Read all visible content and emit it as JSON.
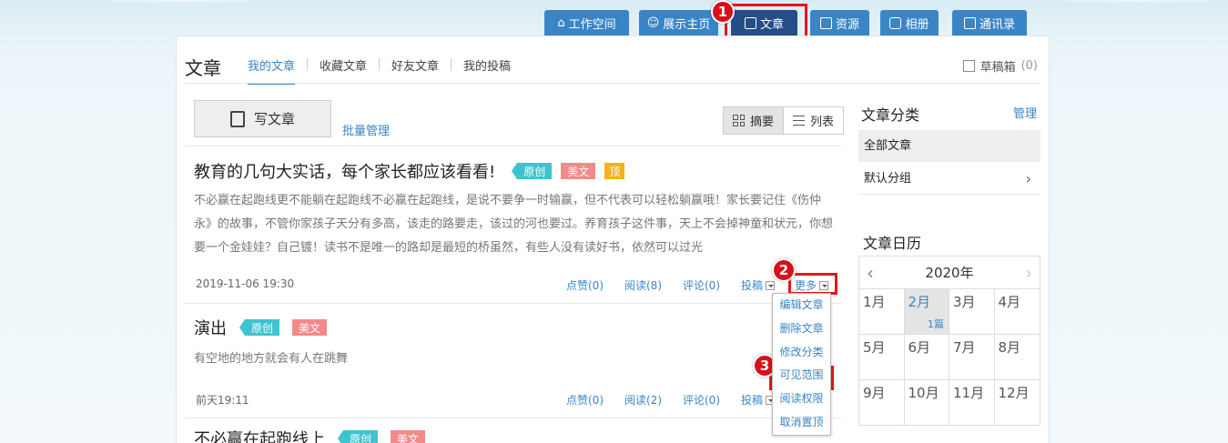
{
  "topnav": [
    {
      "label": "工作空间",
      "icon": "home-icon"
    },
    {
      "label": "展示主页",
      "icon": "user-icon"
    },
    {
      "label": "文章",
      "icon": "document-icon",
      "active": true
    },
    {
      "label": "资源",
      "icon": "file-icon"
    },
    {
      "label": "相册",
      "icon": "camera-icon"
    },
    {
      "label": "通讯录",
      "icon": "contacts-icon"
    }
  ],
  "callouts": [
    "1",
    "2",
    "3"
  ],
  "header": {
    "title": "文章",
    "tabs": [
      "我的文章",
      "收藏文章",
      "好友文章",
      "我的投稿"
    ],
    "drafts_label": "草稿箱",
    "drafts_count": "(0)"
  },
  "toolbar": {
    "write_label": "写文章",
    "batch_label": "批量管理",
    "view_summary": "摘要",
    "view_list": "列表"
  },
  "articles": [
    {
      "title": "教育的几句大实话，每个家长都应该看看!",
      "tags": [
        "原创",
        "美文",
        "顶"
      ],
      "desc": "不必赢在起跑线更不能躺在起跑线不必赢在起跑线，是说不要争一时输赢，但不代表可以轻松躺赢哦！家长要记住《伤仲永》的故事，不管你家孩子天分有多高，该走的路要走，该过的河也要过。养育孩子这件事，天上不会掉神童和状元，你想要一个金娃娃？自己镀！读书不是唯一的路却是最短的桥虽然，有些人没有读好书，依然可以过光",
      "date": "2019-11-06 19:30",
      "likes": "点赞(0)",
      "reads": "阅读(8)",
      "comments": "评论(0)",
      "submit": "投稿",
      "more": "更多"
    },
    {
      "title": "演出",
      "tags": [
        "原创",
        "美文"
      ],
      "desc": "有空地的地方就会有人在跳舞",
      "date": "前天19:11",
      "likes": "点赞(0)",
      "reads": "阅读(2)",
      "comments": "评论(0)",
      "submit": "投稿"
    },
    {
      "title": "不必赢在起跑线上",
      "tags": [
        "原创",
        "美文"
      ]
    }
  ],
  "more_menu": [
    "编辑文章",
    "删除文章",
    "修改分类",
    "可见范围",
    "阅读权限",
    "取消置顶"
  ],
  "sidebar": {
    "categories_title": "文章分类",
    "manage_label": "管理",
    "categories": [
      "全部文章",
      "默认分组"
    ],
    "calendar_title": "文章日历",
    "year": "2020年",
    "months": [
      "1月",
      "2月",
      "3月",
      "4月",
      "5月",
      "6月",
      "7月",
      "8月",
      "9月",
      "10月",
      "11月",
      "12月"
    ],
    "feb_count": "1篇"
  },
  "colors": {
    "accent": "#3a85c6",
    "active_nav": "#254d88",
    "highlight": "#e8141b"
  }
}
